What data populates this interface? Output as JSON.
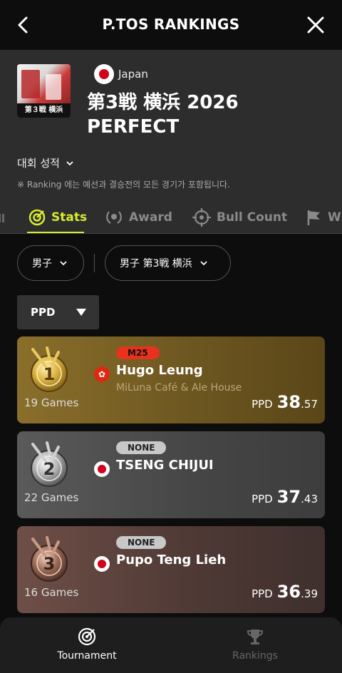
{
  "topbar": {
    "title": "P.TOS RANKINGS",
    "back_icon": "chevron-left-icon",
    "close_icon": "close-icon"
  },
  "event": {
    "thumbnail_caption": "第３戦 横浜",
    "country": "Japan",
    "title_line1": "第3戦 横浜 2026",
    "title_line2": "PERFECT",
    "results_label": "대회 성적",
    "note": "※ Ranking 에는 예선과 결승전의 모든 경기가 포함됩니다."
  },
  "tabs": [
    {
      "label": "Stats",
      "icon": "target-icon",
      "active": true
    },
    {
      "label": "Award",
      "icon": "laurel-icon",
      "active": false
    },
    {
      "label": "Bull Count",
      "icon": "crosshair-icon",
      "active": false
    },
    {
      "label": "W",
      "icon": "flag-icon",
      "active": false
    }
  ],
  "filters": {
    "gender": "男子",
    "division": "男子 第3戦 横浜"
  },
  "sort": {
    "selected": "PPD"
  },
  "players": [
    {
      "rank": "1",
      "badge": "M25",
      "name": "Hugo Leung",
      "store": "MiLuna Café & Ale House",
      "flag": "hong-kong-flag-icon",
      "games": "19 Games",
      "ppd_label": "PPD",
      "ppd_int": "38",
      "ppd_dec": ".57"
    },
    {
      "rank": "2",
      "badge": "NONE",
      "name": "TSENG CHIJUI",
      "store": "",
      "flag": "japan-flag-icon",
      "games": "22 Games",
      "ppd_label": "PPD",
      "ppd_int": "37",
      "ppd_dec": ".43"
    },
    {
      "rank": "3",
      "badge": "NONE",
      "name": "Pupo Teng Lieh",
      "store": "",
      "flag": "japan-flag-icon",
      "games": "16 Games",
      "ppd_label": "PPD",
      "ppd_int": "36",
      "ppd_dec": ".39"
    }
  ],
  "bottomnav": [
    {
      "label": "Tournament",
      "icon": "dartboard-icon",
      "active": true
    },
    {
      "label": "Rankings",
      "icon": "trophy-icon",
      "active": false
    }
  ],
  "colors": {
    "accent": "#d8ec2c",
    "gold_card": "#8a6f2b",
    "silver_card": "#5a5a5a",
    "bronze_card": "#6e4f47",
    "badge_m25": "#e8321e"
  }
}
